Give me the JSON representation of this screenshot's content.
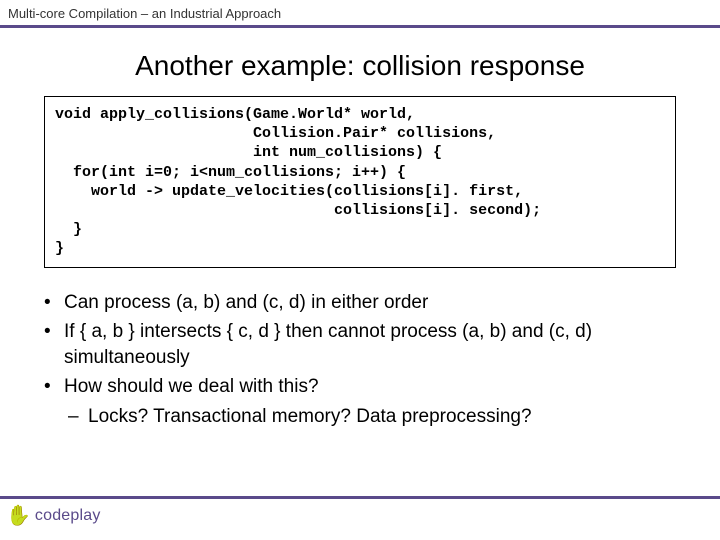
{
  "header": {
    "title": "Multi-core Compilation – an Industrial Approach"
  },
  "slide": {
    "title": "Another example: collision response"
  },
  "code": {
    "text": "void apply_collisions(Game.World* world,\n                      Collision.Pair* collisions,\n                      int num_collisions) {\n  for(int i=0; i<num_collisions; i++) {\n    world -> update_velocities(collisions[i]. first,\n                               collisions[i]. second);\n  }\n}"
  },
  "bullets": {
    "b1": "Can process (a, b) and (c, d) in either order",
    "b2": "If { a, b } intersects { c, d } then cannot process (a, b) and (c, d) simultaneously",
    "b3": "How should we deal with this?",
    "b3a": "Locks?  Transactional memory?  Data preprocessing?"
  },
  "footer": {
    "brand": "codeplay"
  }
}
